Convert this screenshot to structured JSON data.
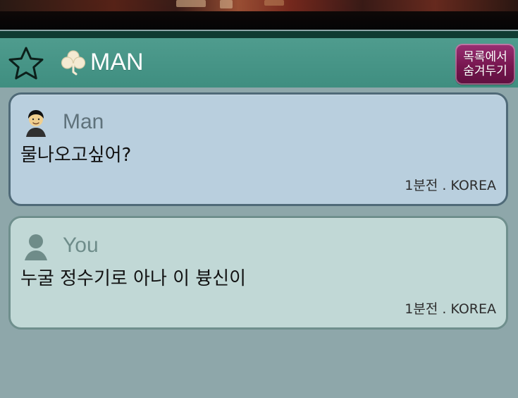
{
  "header": {
    "title": "MAN",
    "hide_button_line1": "목록에서",
    "hide_button_line2": "숨겨두기",
    "icons": {
      "favorite": "star-icon",
      "clover": "clover-icon"
    }
  },
  "messages": [
    {
      "sender": "Man",
      "text": "물나오고싶어?",
      "meta": "1분전 . KOREA",
      "avatar_icon": "man-avatar-icon"
    },
    {
      "sender": "You",
      "text": "누굴 정수기로 아나 이 븅신이",
      "meta": "1분전 . KOREA",
      "avatar_icon": "user-silhouette-icon"
    }
  ],
  "colors": {
    "header_bg": "#449385",
    "hide_button_bg": "#77164f",
    "man_card_bg": "#b9cfde",
    "you_card_bg": "#c1d8d6",
    "page_bg": "#8ea7aa"
  }
}
